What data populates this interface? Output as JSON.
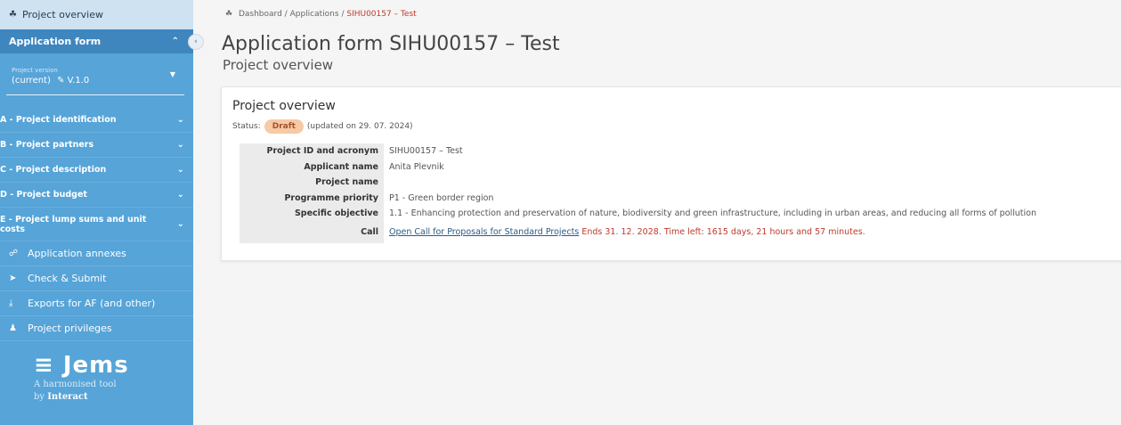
{
  "sidebar": {
    "project_overview": "Project overview",
    "application_form": "Application form",
    "version": {
      "label": "Project version",
      "value": "(current)",
      "number": "V.1.0"
    },
    "sections": [
      {
        "label": "A - Project identification"
      },
      {
        "label": "B - Project partners"
      },
      {
        "label": "C - Project description"
      },
      {
        "label": "D - Project budget"
      },
      {
        "label": "E - Project lump sums and unit costs"
      }
    ],
    "links": [
      {
        "label": "Application annexes",
        "icon": "link-icon"
      },
      {
        "label": "Check & Submit",
        "icon": "send-icon"
      },
      {
        "label": "Exports for AF (and other)",
        "icon": "download-icon"
      },
      {
        "label": "Project privileges",
        "icon": "users-icon"
      }
    ],
    "logo": {
      "name": "Jems",
      "tagline": "A harmonised tool",
      "by": "by",
      "org": "Interact"
    }
  },
  "breadcrumb": {
    "home": "Dashboard",
    "sep": "/",
    "section": "Applications",
    "current": "SIHU00157 – Test"
  },
  "header": {
    "title": "Application form SIHU00157 – Test",
    "subtitle": "Project overview"
  },
  "card": {
    "title": "Project overview",
    "status_label": "Status:",
    "status": "Draft",
    "updated": "(updated on 29. 07. 2024)",
    "rows": [
      {
        "key": "Project ID and acronym",
        "value": "SIHU00157 – Test"
      },
      {
        "key": "Applicant name",
        "value": "Anita Plevnik"
      },
      {
        "key": "Project name",
        "value": ""
      },
      {
        "key": "Programme priority",
        "value": "P1 - Green border region"
      },
      {
        "key": "Specific objective",
        "value": "1.1 - Enhancing protection and preservation of nature, biodiversity and green infrastructure, including in urban areas, and reducing all forms of pollution"
      }
    ],
    "call": {
      "key": "Call",
      "link": "Open Call for Proposals for Standard Projects",
      "ends": "Ends 31. 12. 2028. Time left: 1615 days, 21 hours and 57 minutes."
    }
  },
  "colors": {
    "sidebar": "#56a4d8",
    "accent": "#3f86bf",
    "draft_badge": "#f7c9a4",
    "warning_text": "#c0392b"
  }
}
